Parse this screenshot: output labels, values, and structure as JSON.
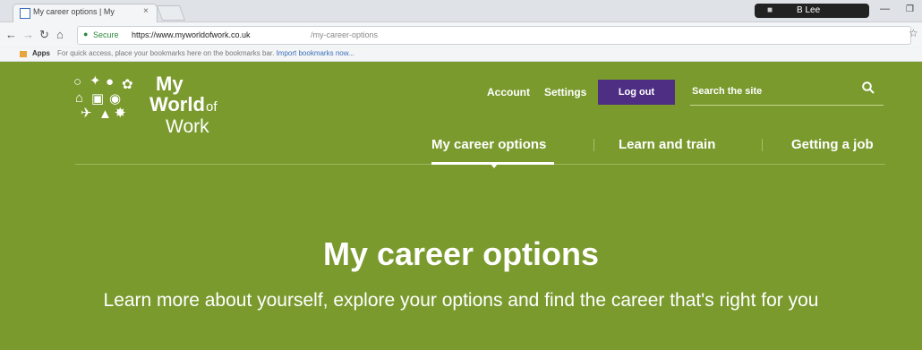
{
  "browser": {
    "tab_title": "My career options | My",
    "tab_close": "×",
    "user_name": "B Lee",
    "secure_label": "Secure",
    "url_base": "https://www.myworldofwork.co.uk",
    "url_path": "/my-career-options",
    "apps_label": "Apps",
    "bookmarks_hint": "For quick access, place your bookmarks here on the bookmarks bar.",
    "import_link": "Import bookmarks now..."
  },
  "header": {
    "logo_line1": "My",
    "logo_line2": "World",
    "logo_of": "of",
    "logo_line3": "Work",
    "account": "Account",
    "settings": "Settings",
    "logout": "Log out",
    "search_placeholder": "Search the site"
  },
  "main_nav": {
    "items": [
      {
        "label": "My career options"
      },
      {
        "label": "Learn and train"
      },
      {
        "label": "Getting a job"
      }
    ]
  },
  "hero": {
    "title": "My career options",
    "subtitle": "Learn more about yourself, explore your options and find the career that's right for you"
  },
  "colors": {
    "brand_green": "#7a9a2e",
    "logout_purple": "#4e2e83"
  }
}
